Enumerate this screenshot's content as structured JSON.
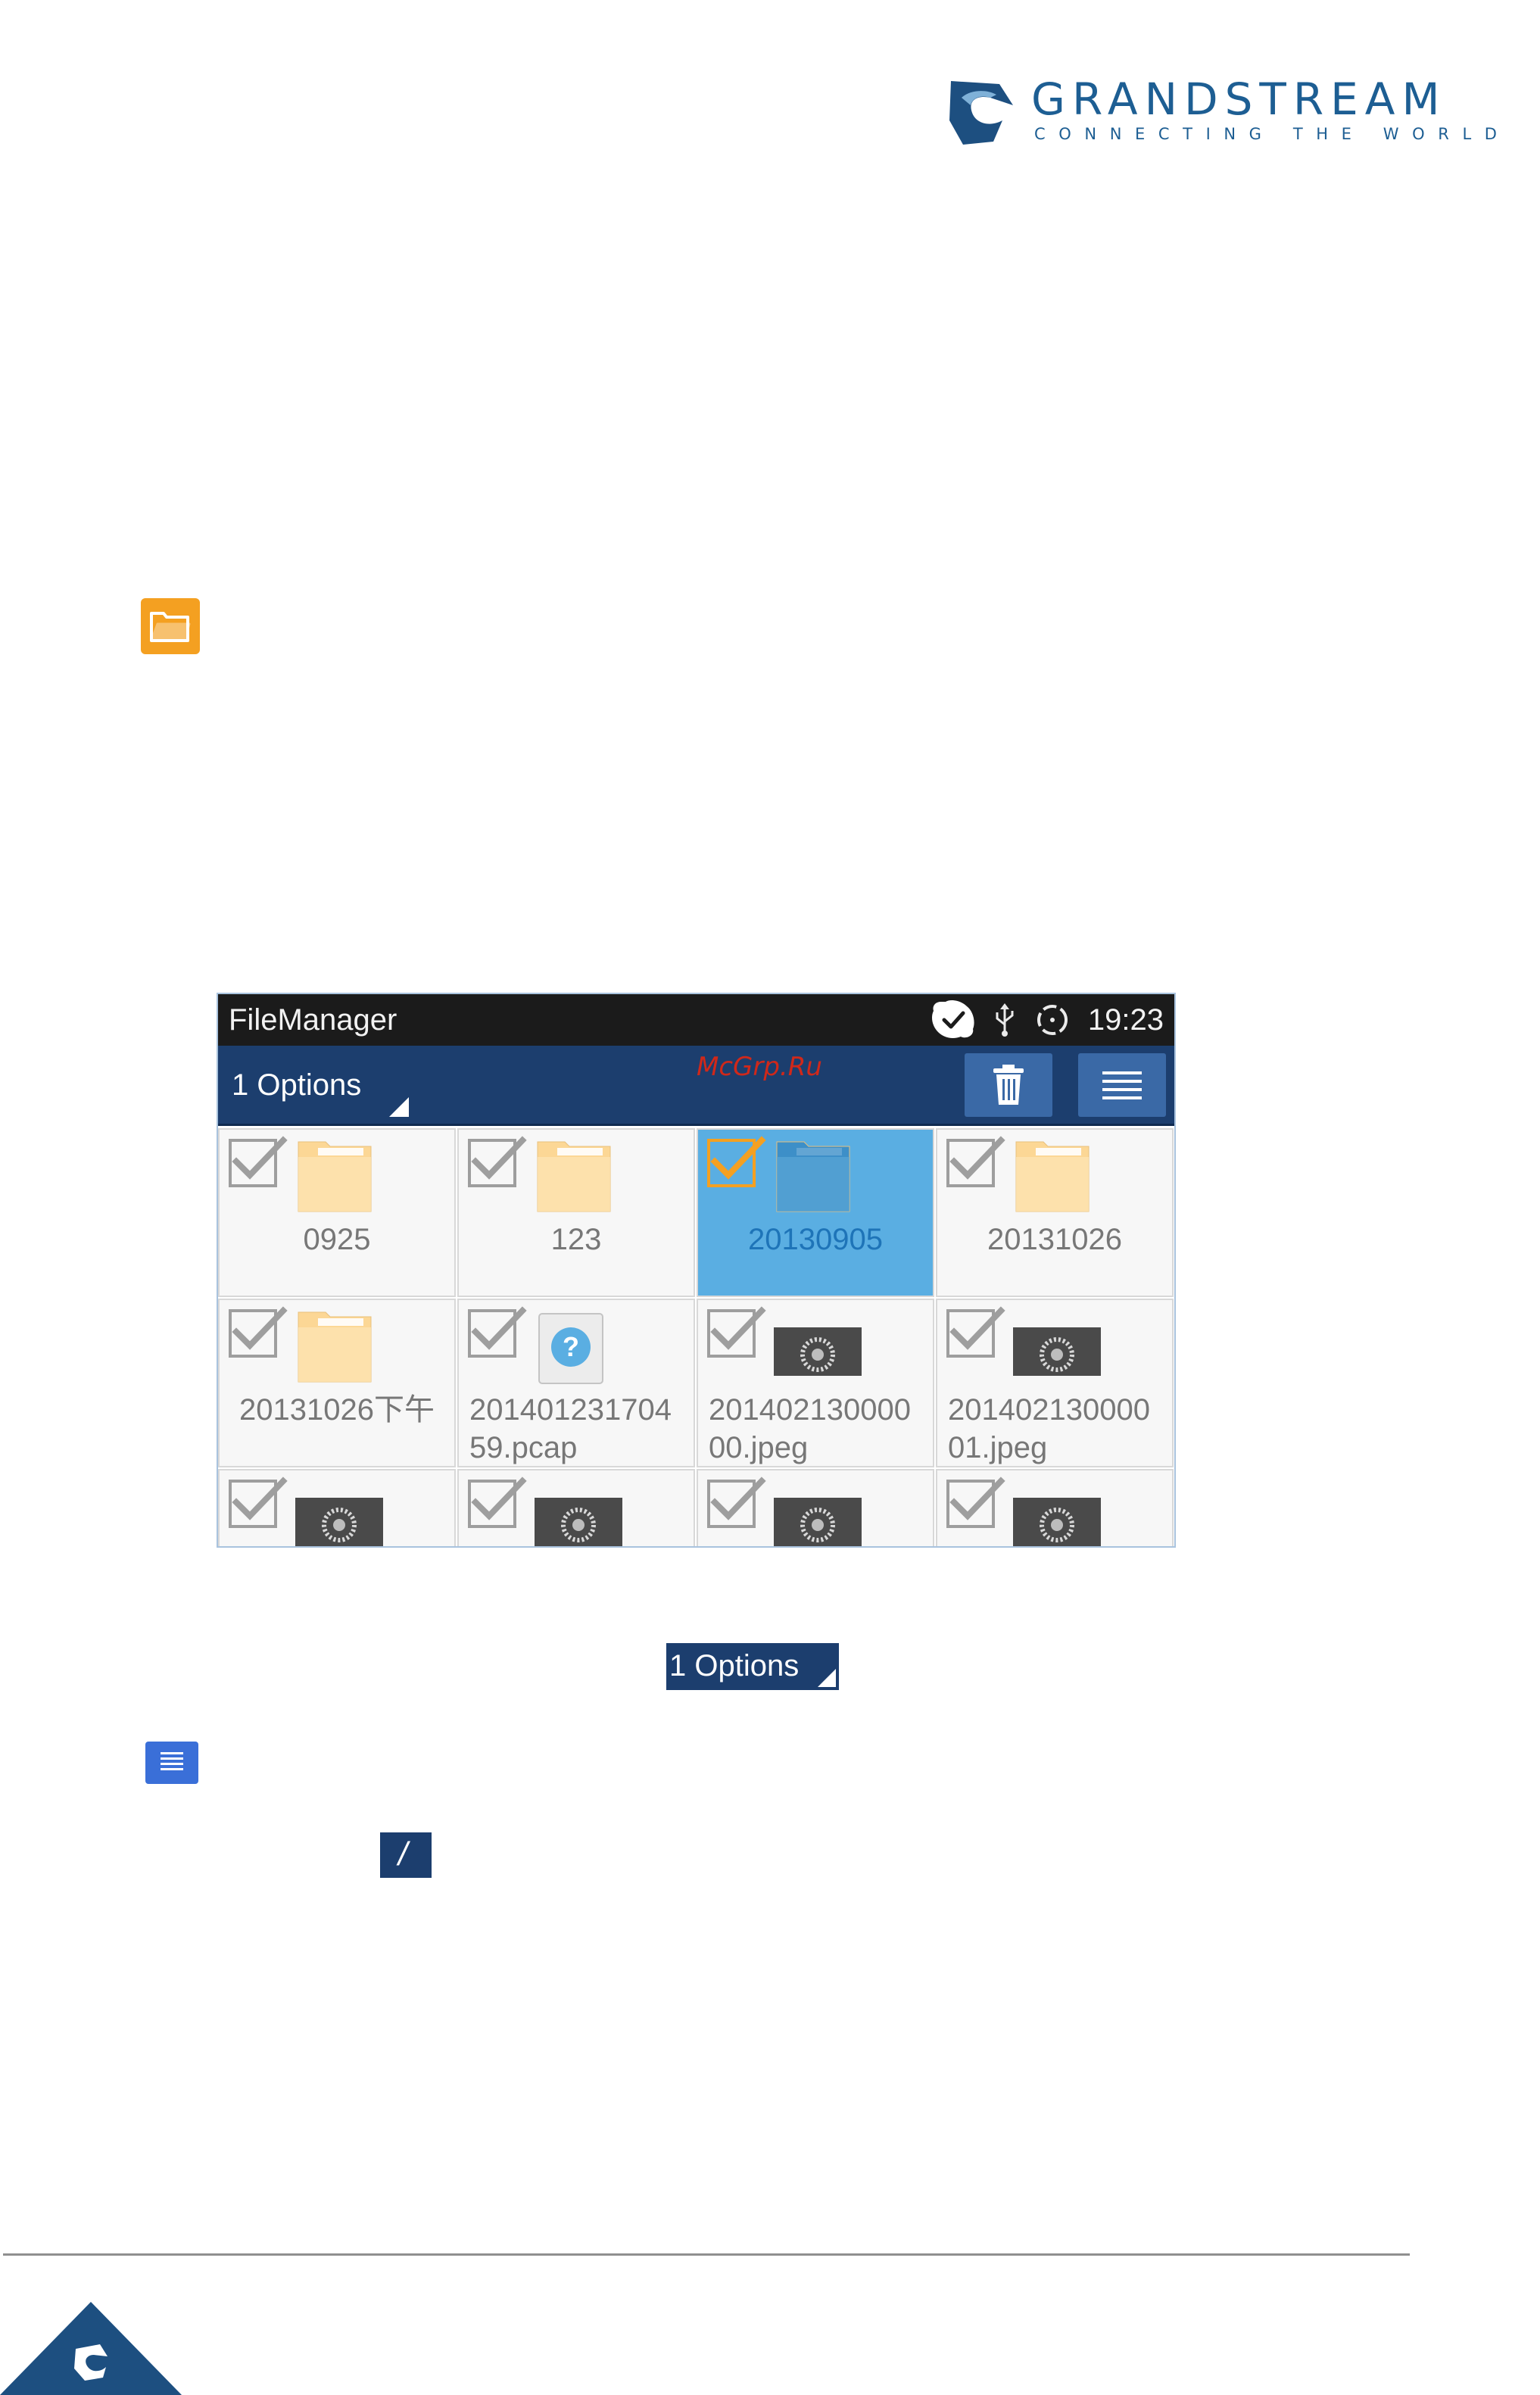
{
  "brand": {
    "name": "GRANDSTREAM",
    "tagline": "CONNECTING THE WORLD",
    "color": "#1d5e93"
  },
  "icons": {
    "page_app_icon": "filemanager-folder-icon",
    "status": [
      "skype-icon",
      "usb-icon",
      "sync-icon"
    ],
    "actions": [
      "trash-icon",
      "menu-icon"
    ]
  },
  "screen": {
    "status_bar": {
      "app_title": "FileManager",
      "time": "19:23"
    },
    "action_bar": {
      "options_label": "1 Options",
      "accent": "#1c3e6e"
    },
    "files": [
      {
        "name": "0925",
        "type": "folder",
        "selected": false
      },
      {
        "name": "123",
        "type": "folder",
        "selected": false
      },
      {
        "name": "20130905",
        "type": "folder",
        "selected": true
      },
      {
        "name": "20131026",
        "type": "folder",
        "selected": false
      },
      {
        "name": "20131026下午",
        "type": "folder",
        "selected": false
      },
      {
        "name": "201401231704\n59.pcap",
        "type": "unknown",
        "selected": false
      },
      {
        "name": "201402130000\n00.jpeg",
        "type": "image",
        "selected": false
      },
      {
        "name": "201402130000\n01.jpeg",
        "type": "image",
        "selected": false
      },
      {
        "name": "",
        "type": "image",
        "selected": false
      },
      {
        "name": "",
        "type": "image",
        "selected": false
      },
      {
        "name": "",
        "type": "image",
        "selected": false
      },
      {
        "name": "",
        "type": "image",
        "selected": false
      }
    ],
    "selection_color": "#5aaee2",
    "watermark": "McGrp.Ru"
  },
  "inline_controls": {
    "options_label": "1 Options",
    "slash_label": "/"
  }
}
